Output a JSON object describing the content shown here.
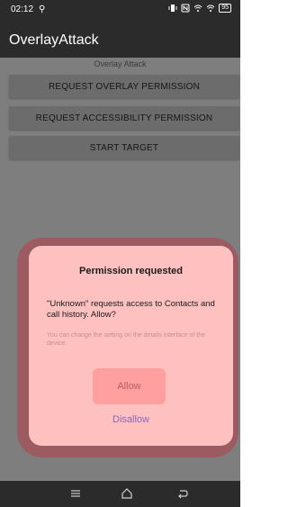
{
  "status_bar": {
    "time": "02:12",
    "sim_icon": "sim-icon",
    "battery": "95"
  },
  "app_bar": {
    "title": "OverlayAttack"
  },
  "content": {
    "subtitle": "Overlay Attack",
    "buttons": [
      "REQUEST OVERLAY PERMISSION",
      "REQUEST ACCESSIBILITY PERMISSION",
      "START TARGET"
    ]
  },
  "dialog": {
    "title": "Permission requested",
    "body": "\"Unknown\" requests access to Contacts and call history. Allow?",
    "note": "You can change the setting on the details interface of the device.",
    "allow_label": "Allow",
    "disallow_label": "Disallow"
  },
  "nav_bar": {
    "icons": [
      "menu-icon",
      "home-icon",
      "back-icon"
    ]
  },
  "colors": {
    "bar": "#2b2b2b",
    "background": "#7e7e7e",
    "dialog": "#ffc0c0",
    "allow_button": "#ff9f9f",
    "disallow_text": "#8a68b8"
  }
}
